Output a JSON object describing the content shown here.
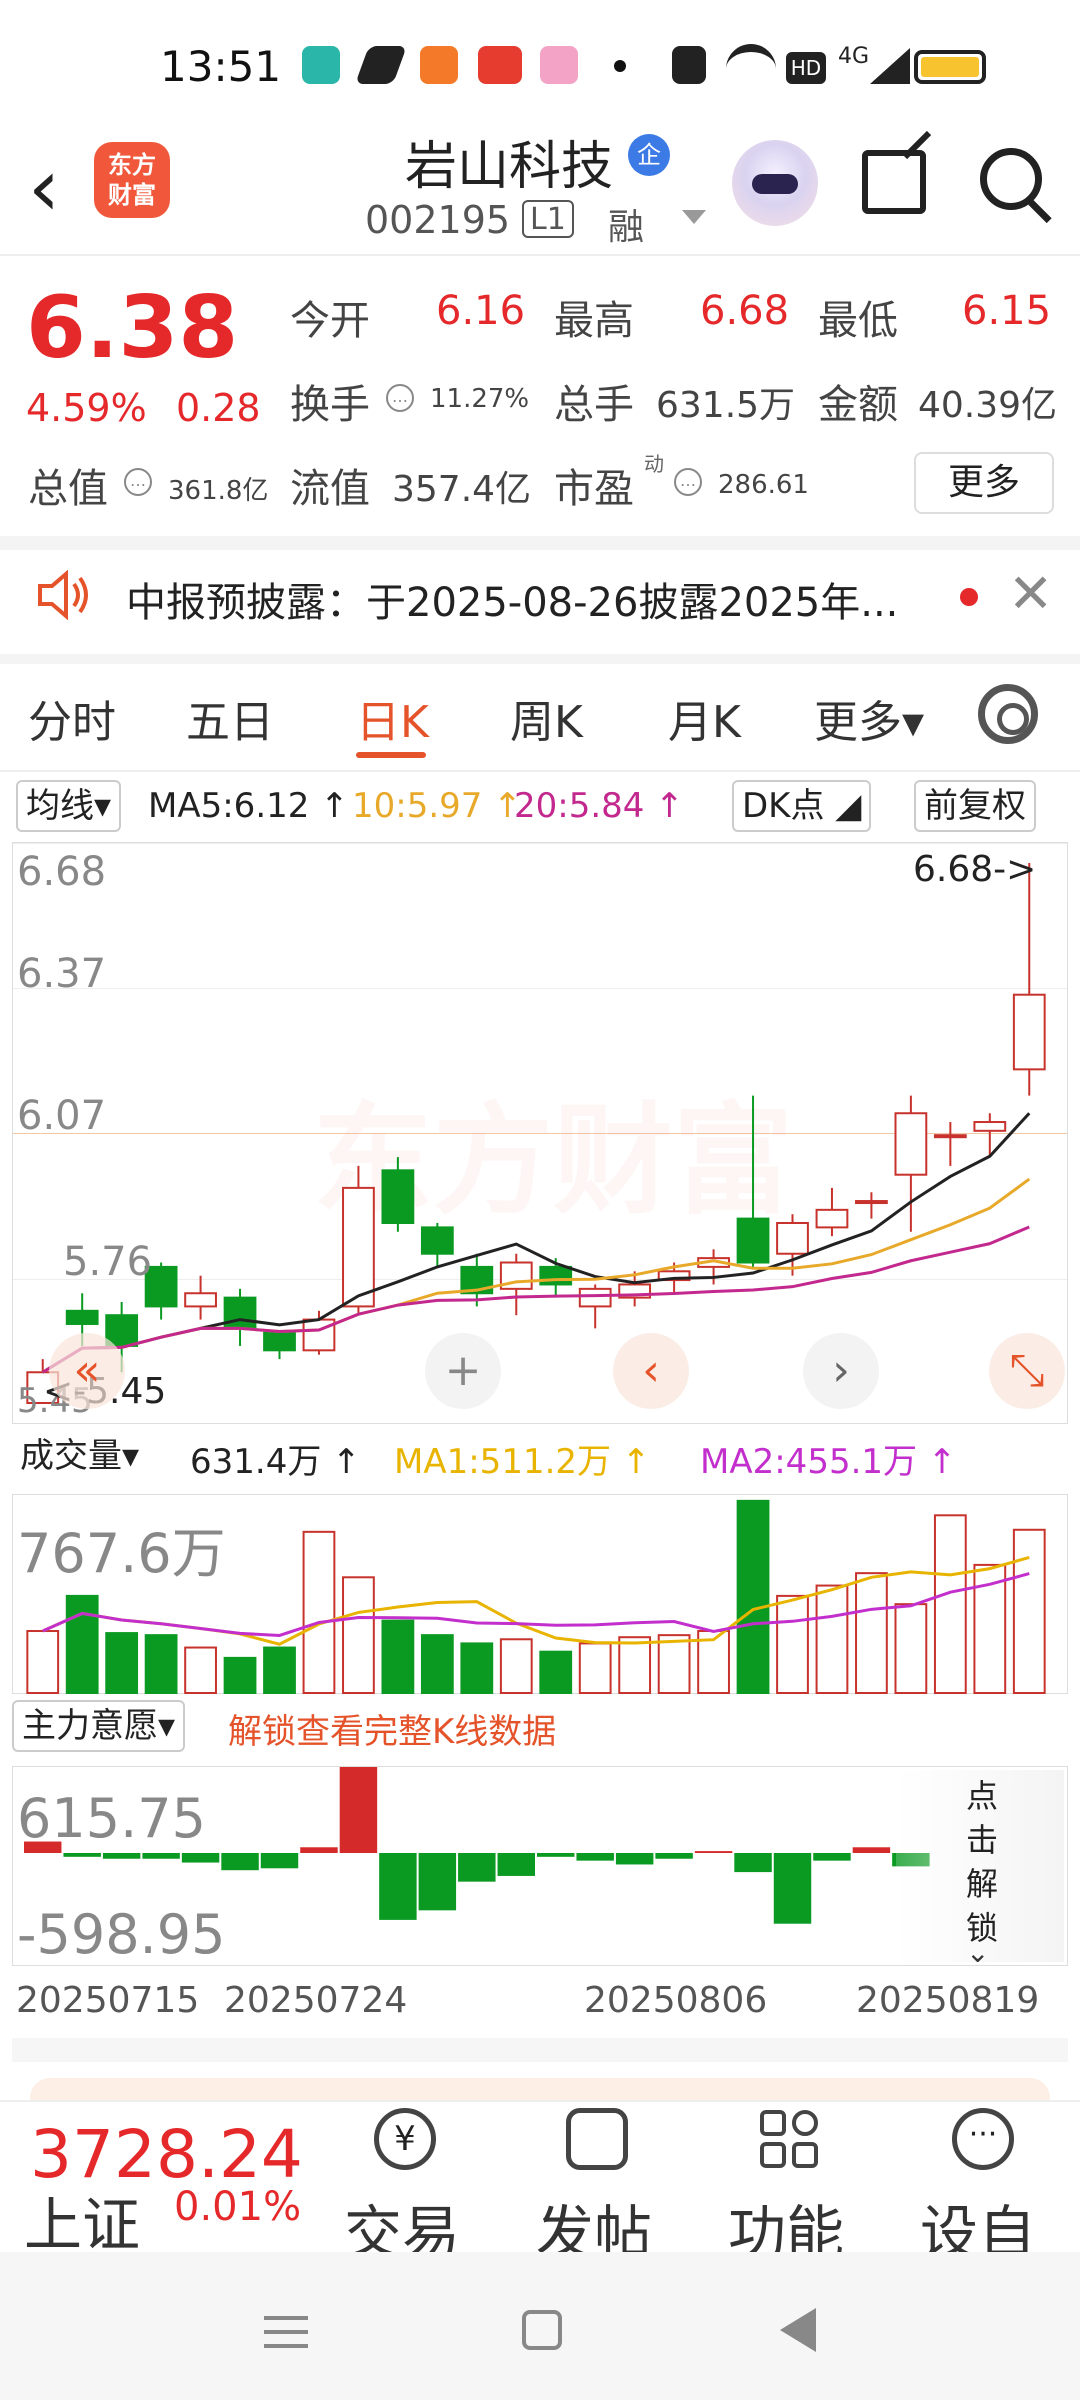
{
  "status": {
    "time": "13:51",
    "signal": "4G"
  },
  "header": {
    "logo": "东方财富",
    "name": "岩山科技",
    "badge": "企",
    "code": "002195",
    "tag1": "L1",
    "tag2": "融"
  },
  "quote": {
    "price": "6.38",
    "pct": "4.59%",
    "change": "0.28",
    "open_label": "今开",
    "open": "6.16",
    "high_label": "最高",
    "high": "6.68",
    "low_label": "最低",
    "low": "6.15",
    "turnover_label": "换手",
    "turnover": "11.27%",
    "volume_label": "总手",
    "volume": "631.5万",
    "amount_label": "金额",
    "amount": "40.39亿",
    "mcap_label": "总值",
    "mcap": "361.8亿",
    "float_label": "流值",
    "float": "357.4亿",
    "pe_label": "市盈",
    "pe_sup": "动",
    "pe": "286.61",
    "more": "更多"
  },
  "notice": {
    "text": "中报预披露：于2025-08-26披露2025年..."
  },
  "tabs": [
    "分时",
    "五日",
    "日K",
    "周K",
    "月K",
    "更多▾"
  ],
  "chart_header": {
    "ma_select": "均线▾",
    "ma5": "MA5:6.12 ↑",
    "ma10": "10:5.97 ↑",
    "ma20": "20:5.84 ↑",
    "dk": "DK点 ◢",
    "adjust": "前复权"
  },
  "kline": {
    "yticks": [
      "6.68",
      "6.37",
      "6.07",
      "5.76",
      "5.45"
    ],
    "high_marker": "6.68->",
    "low_marker": "<-5.45",
    "watermark": "东方财富"
  },
  "volume": {
    "select": "成交量▾",
    "value": "631.4万 ↑",
    "ma1": "MA1:511.2万 ↑",
    "ma2": "MA2:455.1万 ↑",
    "ytop": "767.6万"
  },
  "zhuli": {
    "select": "主力意愿▾",
    "unlock": "解锁查看完整K线数据",
    "ytop": "615.75",
    "ybottom": "-598.95",
    "panel": "点击解锁"
  },
  "dates": [
    "20250715",
    "20250724",
    "20250806",
    "20250819"
  ],
  "bottom": {
    "index_value": "3728.24",
    "index_name": "上证",
    "index_change": "0.01%",
    "items": [
      "交易",
      "发帖",
      "功能",
      "设自"
    ]
  },
  "chart_data": {
    "type": "candlestick",
    "ylim": [
      5.45,
      6.68
    ],
    "candles": [
      {
        "o": 5.45,
        "c": 5.52,
        "h": 5.55,
        "l": 5.45
      },
      {
        "o": 5.66,
        "c": 5.63,
        "h": 5.7,
        "l": 5.58
      },
      {
        "o": 5.65,
        "c": 5.58,
        "h": 5.68,
        "l": 5.52
      },
      {
        "o": 5.76,
        "c": 5.67,
        "h": 5.77,
        "l": 5.64
      },
      {
        "o": 5.67,
        "c": 5.7,
        "h": 5.74,
        "l": 5.64
      },
      {
        "o": 5.69,
        "c": 5.62,
        "h": 5.71,
        "l": 5.58
      },
      {
        "o": 5.61,
        "c": 5.57,
        "h": 5.61,
        "l": 5.55
      },
      {
        "o": 5.57,
        "c": 5.64,
        "h": 5.66,
        "l": 5.56
      },
      {
        "o": 5.67,
        "c": 5.94,
        "h": 5.99,
        "l": 5.65
      },
      {
        "o": 5.98,
        "c": 5.86,
        "h": 6.01,
        "l": 5.84
      },
      {
        "o": 5.85,
        "c": 5.79,
        "h": 5.86,
        "l": 5.76
      },
      {
        "o": 5.76,
        "c": 5.7,
        "h": 5.79,
        "l": 5.67
      },
      {
        "o": 5.71,
        "c": 5.77,
        "h": 5.79,
        "l": 5.65
      },
      {
        "o": 5.76,
        "c": 5.72,
        "h": 5.78,
        "l": 5.69
      },
      {
        "o": 5.67,
        "c": 5.71,
        "h": 5.72,
        "l": 5.62
      },
      {
        "o": 5.69,
        "c": 5.72,
        "h": 5.75,
        "l": 5.67
      },
      {
        "o": 5.73,
        "c": 5.75,
        "h": 5.77,
        "l": 5.7
      },
      {
        "o": 5.76,
        "c": 5.78,
        "h": 5.8,
        "l": 5.72
      },
      {
        "o": 5.87,
        "c": 5.77,
        "h": 6.15,
        "l": 5.76
      },
      {
        "o": 5.79,
        "c": 5.86,
        "h": 5.88,
        "l": 5.74
      },
      {
        "o": 5.85,
        "c": 5.89,
        "h": 5.94,
        "l": 5.83
      },
      {
        "o": 5.91,
        "c": 5.91,
        "h": 5.93,
        "l": 5.87
      },
      {
        "o": 5.97,
        "c": 6.11,
        "h": 6.15,
        "l": 5.84
      },
      {
        "o": 6.06,
        "c": 6.06,
        "h": 6.09,
        "l": 5.99
      },
      {
        "o": 6.07,
        "c": 6.09,
        "h": 6.11,
        "l": 6.01
      },
      {
        "o": 6.21,
        "c": 6.38,
        "h": 6.68,
        "l": 6.15
      }
    ],
    "volume": [
      300,
      470,
      290,
      280,
      220,
      170,
      220,
      780,
      560,
      350,
      280,
      240,
      260,
      200,
      240,
      270,
      280,
      300,
      930,
      470,
      520,
      580,
      430,
      860,
      620,
      790
    ],
    "zhuli": [
      60,
      -20,
      -30,
      -30,
      -50,
      -90,
      -80,
      30,
      450,
      -350,
      -300,
      -150,
      -120,
      -20,
      -40,
      -60,
      -30,
      10,
      -100,
      -370,
      -40,
      30,
      -70,
      0,
      0,
      0
    ]
  }
}
